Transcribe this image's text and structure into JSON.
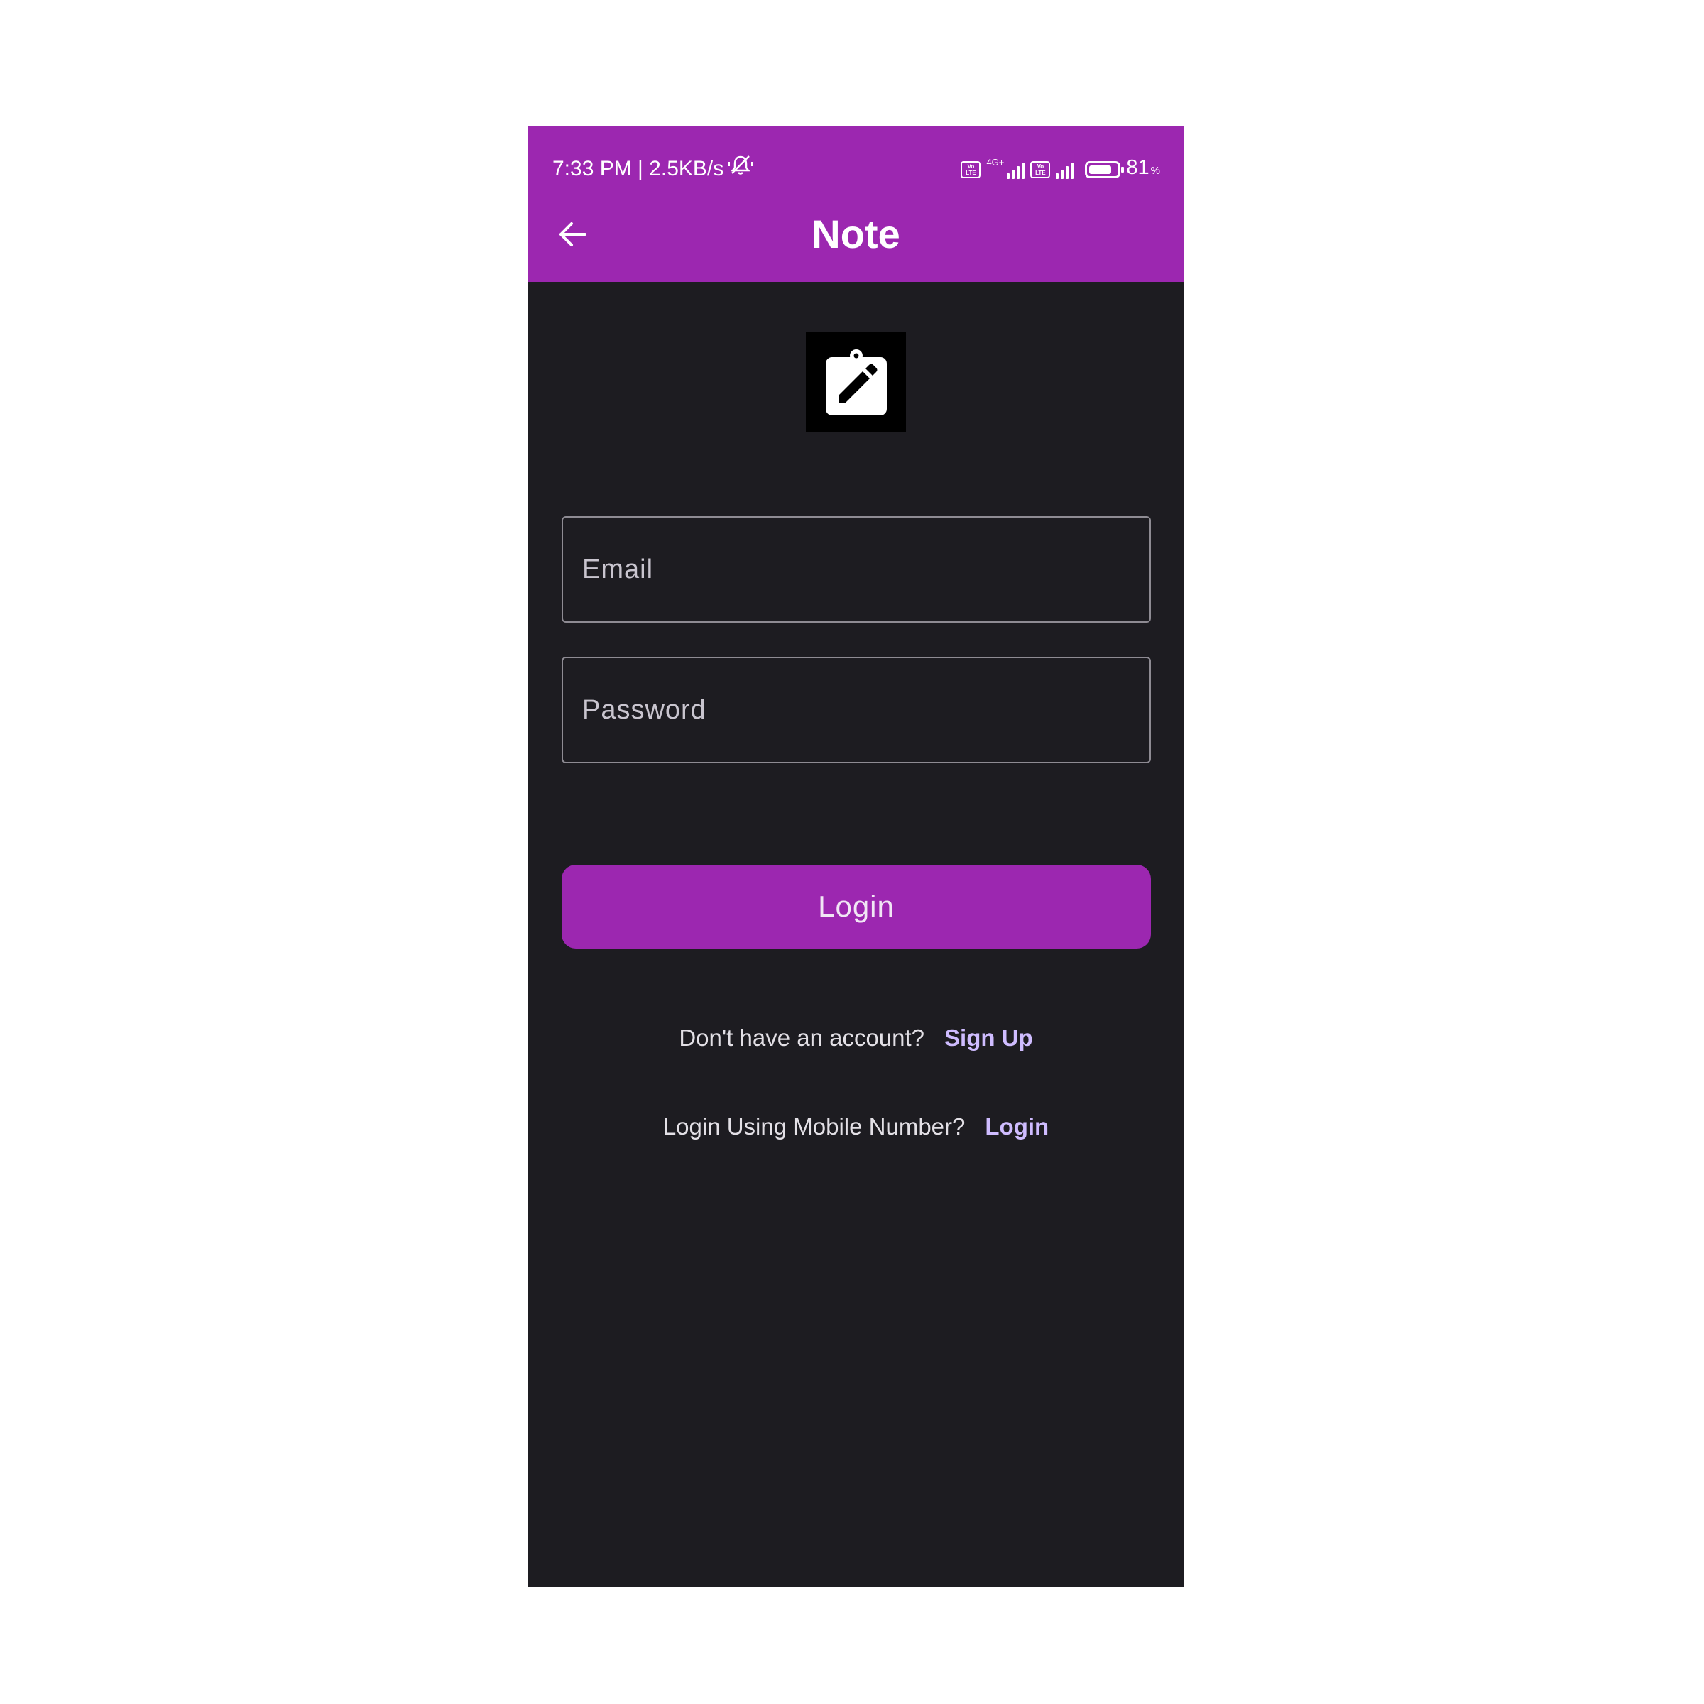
{
  "status_bar": {
    "time_speed": "7:33 PM | 2.5KB/s",
    "network_label": "4G+",
    "volte_label": "Vo LTE",
    "battery_percent": "81",
    "battery_unit": "%",
    "battery_level": 0.81,
    "icons": [
      "silent-alarm-icon",
      "volte-icon",
      "signal-icon",
      "battery-icon"
    ]
  },
  "app_bar": {
    "title": "Note",
    "back_icon": "arrow-left-icon"
  },
  "logo": {
    "icon": "clipboard-edit-icon"
  },
  "form": {
    "email_placeholder": "Email",
    "email_value": "",
    "password_placeholder": "Password",
    "password_value": "",
    "login_button": "Login"
  },
  "links": {
    "signup_prompt": "Don't have an account?",
    "signup_link": "Sign Up",
    "mobile_prompt": "Login Using Mobile Number?",
    "mobile_link": "Login"
  },
  "colors": {
    "primary": "#9c27b0",
    "background": "#1d1c21",
    "link": "#cfbcff"
  }
}
